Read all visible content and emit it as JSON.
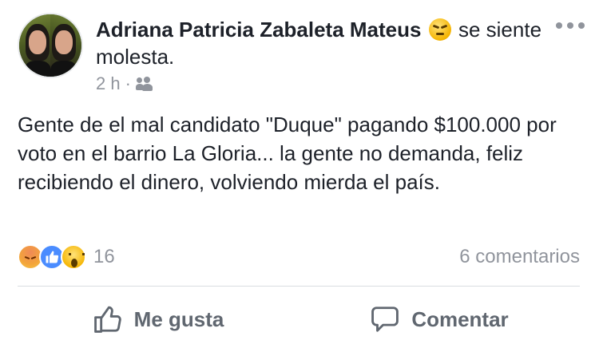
{
  "post": {
    "author": "Adriana Patricia Zabaleta Mateus",
    "feeling_pre": "se",
    "feeling_text": "siente molesta.",
    "feeling_icon": "angry-face-emoji",
    "time": "2 h",
    "separator": "·",
    "audience_icon": "friends-icon",
    "body": "Gente de el mal candidato \"Duque\" pagando $100.000 por voto en el barrio La Gloria... la gente no demanda, feliz recibiendo el dinero, volviendo mierda el país."
  },
  "reactions": {
    "icons": [
      "angry-reaction-icon",
      "like-reaction-icon",
      "wow-reaction-icon"
    ],
    "count": "16",
    "comments": "6 comentarios"
  },
  "actions": {
    "like_label": "Me gusta",
    "comment_label": "Comentar"
  },
  "colors": {
    "text": "#1d2129",
    "muted": "#90949c",
    "action": "#606770",
    "like_blue": "#4a8cff"
  }
}
